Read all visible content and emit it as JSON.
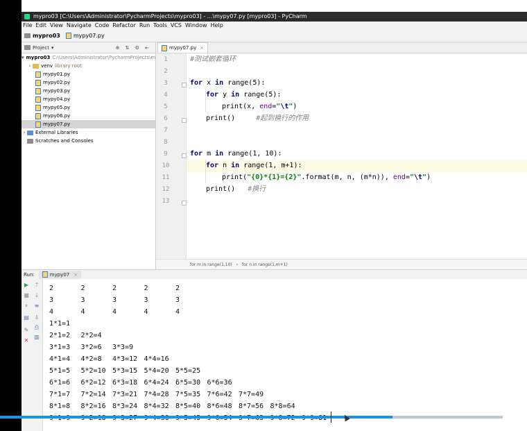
{
  "window": {
    "title": "mypro03 [C:\\Users\\Administrator\\PycharmProjects\\mypro03] - ...\\mypy07.py [mypro03] - PyCharm"
  },
  "menu": [
    "File",
    "Edit",
    "View",
    "Navigate",
    "Code",
    "Refactor",
    "Run",
    "Tools",
    "VCS",
    "Window",
    "Help"
  ],
  "nav": {
    "project": "mypro03",
    "file": "mypy07.py"
  },
  "project_panel": {
    "header": "Project",
    "root_name": "mypro03",
    "root_path": "C:\\Users\\Administrator\\PycharmProjects\\m",
    "venv": "venv",
    "venv_note": "library root",
    "files": [
      "mypy01.py",
      "mypy02.py",
      "mypy03.py",
      "mypy04.py",
      "mypy05.py",
      "mypy06.py",
      "mypy07.py"
    ],
    "selected_file": "mypy07.py",
    "external": "External Libraries",
    "scratches": "Scratches and Consoles"
  },
  "editor": {
    "tab": "mypy07.py",
    "line_numbers": [
      "1",
      "2",
      "3",
      "4",
      "5",
      "6",
      "7",
      "8",
      "9",
      "10",
      "11",
      "12",
      "13"
    ],
    "code": {
      "l1_comment": "#测试嵌套循环",
      "l3_for": "for",
      "l3_a": " x ",
      "l3_in": "in",
      "l3_b": " range(5):",
      "l4_for": "for",
      "l4_a": " y ",
      "l4_in": "in",
      "l4_b": " range(5):",
      "l5_a": "print(x,",
      "l5_kw": "end",
      "l5_eq": "=",
      "l5_str1": "\"",
      "l5_esc": "\\t",
      "l5_str2": "\"",
      "l5_close": ")",
      "l6_code": "print()",
      "l6_comment": "#起到换行的作用",
      "l9_for": "for",
      "l9_a": " m ",
      "l9_in": "in",
      "l9_b": " range(1, 10):",
      "l10_for": "for",
      "l10_a": " n ",
      "l10_in": "in",
      "l10_b": " range(1, m+1):",
      "l11_a": "print(",
      "l11_str": "\"{0}*{1}={2}\"",
      "l11_b": ".format(m, n, (m*n)),",
      "l11_kw": "end",
      "l11_eq": "=",
      "l11_s1": "\"",
      "l11_esc": "\\t",
      "l11_s2": "\"",
      "l11_close": ")",
      "l12_code": "print()",
      "l12_comment": "#换行"
    },
    "breadcrumb": [
      "for m in range(1,10)",
      "for n in range(1,m+1)"
    ]
  },
  "run": {
    "label": "Run:",
    "tab": "mypy07",
    "output": [
      [
        "2",
        "2",
        "2",
        "2",
        "2"
      ],
      [
        "3",
        "3",
        "3",
        "3",
        "3"
      ],
      [
        "4",
        "4",
        "4",
        "4",
        "4"
      ],
      [
        "1*1=1"
      ],
      [
        "2*1=2",
        "2*2=4"
      ],
      [
        "3*1=3",
        "3*2=6",
        "3*3=9"
      ],
      [
        "4*1=4",
        "4*2=8",
        "4*3=12",
        "4*4=16"
      ],
      [
        "5*1=5",
        "5*2=10",
        "5*3=15",
        "5*4=20",
        "5*5=25"
      ],
      [
        "6*1=6",
        "6*2=12",
        "6*3=18",
        "6*4=24",
        "6*5=30",
        "6*6=36"
      ],
      [
        "7*1=7",
        "7*2=14",
        "7*3=21",
        "7*4=28",
        "7*5=35",
        "7*6=42",
        "7*7=49"
      ],
      [
        "8*1=8",
        "8*2=16",
        "8*3=24",
        "8*4=32",
        "8*5=40",
        "8*6=48",
        "8*7=56",
        "8*8=64"
      ],
      [
        "9*1=9",
        "9*2=18",
        "9*3=27",
        "9*4=36",
        "9*5=45",
        "9*6=54",
        "9*7=63",
        "9*8=72",
        "9*9=81"
      ]
    ]
  },
  "video": {
    "progress_fraction": 0.78
  },
  "colors": {
    "keyword": "#000080",
    "comment": "#808080",
    "string": "#008000",
    "progress": "#1e90e6"
  }
}
